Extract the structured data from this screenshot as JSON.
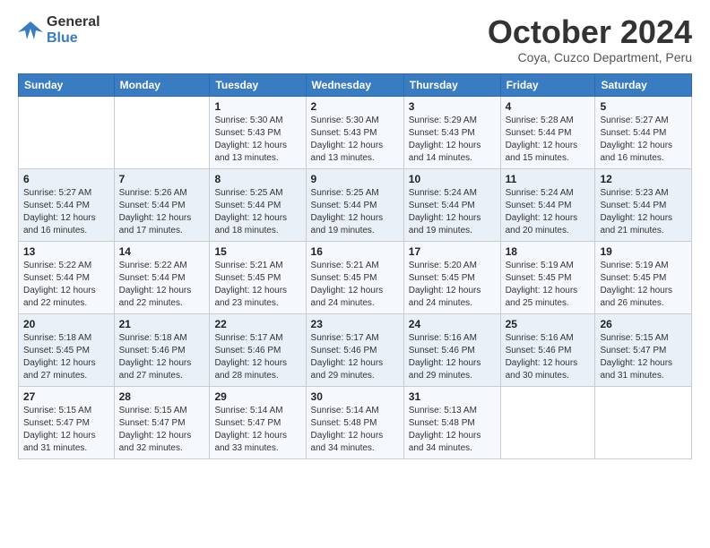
{
  "logo": {
    "general": "General",
    "blue": "Blue"
  },
  "header": {
    "month": "October 2024",
    "location": "Coya, Cuzco Department, Peru"
  },
  "weekdays": [
    "Sunday",
    "Monday",
    "Tuesday",
    "Wednesday",
    "Thursday",
    "Friday",
    "Saturday"
  ],
  "weeks": [
    [
      null,
      null,
      {
        "day": 1,
        "sunrise": "5:30 AM",
        "sunset": "5:43 PM",
        "daylight": "12 hours and 13 minutes."
      },
      {
        "day": 2,
        "sunrise": "5:30 AM",
        "sunset": "5:43 PM",
        "daylight": "12 hours and 13 minutes."
      },
      {
        "day": 3,
        "sunrise": "5:29 AM",
        "sunset": "5:43 PM",
        "daylight": "12 hours and 14 minutes."
      },
      {
        "day": 4,
        "sunrise": "5:28 AM",
        "sunset": "5:44 PM",
        "daylight": "12 hours and 15 minutes."
      },
      {
        "day": 5,
        "sunrise": "5:27 AM",
        "sunset": "5:44 PM",
        "daylight": "12 hours and 16 minutes."
      }
    ],
    [
      {
        "day": 6,
        "sunrise": "5:27 AM",
        "sunset": "5:44 PM",
        "daylight": "12 hours and 16 minutes."
      },
      {
        "day": 7,
        "sunrise": "5:26 AM",
        "sunset": "5:44 PM",
        "daylight": "12 hours and 17 minutes."
      },
      {
        "day": 8,
        "sunrise": "5:25 AM",
        "sunset": "5:44 PM",
        "daylight": "12 hours and 18 minutes."
      },
      {
        "day": 9,
        "sunrise": "5:25 AM",
        "sunset": "5:44 PM",
        "daylight": "12 hours and 19 minutes."
      },
      {
        "day": 10,
        "sunrise": "5:24 AM",
        "sunset": "5:44 PM",
        "daylight": "12 hours and 19 minutes."
      },
      {
        "day": 11,
        "sunrise": "5:24 AM",
        "sunset": "5:44 PM",
        "daylight": "12 hours and 20 minutes."
      },
      {
        "day": 12,
        "sunrise": "5:23 AM",
        "sunset": "5:44 PM",
        "daylight": "12 hours and 21 minutes."
      }
    ],
    [
      {
        "day": 13,
        "sunrise": "5:22 AM",
        "sunset": "5:44 PM",
        "daylight": "12 hours and 22 minutes."
      },
      {
        "day": 14,
        "sunrise": "5:22 AM",
        "sunset": "5:44 PM",
        "daylight": "12 hours and 22 minutes."
      },
      {
        "day": 15,
        "sunrise": "5:21 AM",
        "sunset": "5:45 PM",
        "daylight": "12 hours and 23 minutes."
      },
      {
        "day": 16,
        "sunrise": "5:21 AM",
        "sunset": "5:45 PM",
        "daylight": "12 hours and 24 minutes."
      },
      {
        "day": 17,
        "sunrise": "5:20 AM",
        "sunset": "5:45 PM",
        "daylight": "12 hours and 24 minutes."
      },
      {
        "day": 18,
        "sunrise": "5:19 AM",
        "sunset": "5:45 PM",
        "daylight": "12 hours and 25 minutes."
      },
      {
        "day": 19,
        "sunrise": "5:19 AM",
        "sunset": "5:45 PM",
        "daylight": "12 hours and 26 minutes."
      }
    ],
    [
      {
        "day": 20,
        "sunrise": "5:18 AM",
        "sunset": "5:45 PM",
        "daylight": "12 hours and 27 minutes."
      },
      {
        "day": 21,
        "sunrise": "5:18 AM",
        "sunset": "5:46 PM",
        "daylight": "12 hours and 27 minutes."
      },
      {
        "day": 22,
        "sunrise": "5:17 AM",
        "sunset": "5:46 PM",
        "daylight": "12 hours and 28 minutes."
      },
      {
        "day": 23,
        "sunrise": "5:17 AM",
        "sunset": "5:46 PM",
        "daylight": "12 hours and 29 minutes."
      },
      {
        "day": 24,
        "sunrise": "5:16 AM",
        "sunset": "5:46 PM",
        "daylight": "12 hours and 29 minutes."
      },
      {
        "day": 25,
        "sunrise": "5:16 AM",
        "sunset": "5:46 PM",
        "daylight": "12 hours and 30 minutes."
      },
      {
        "day": 26,
        "sunrise": "5:15 AM",
        "sunset": "5:47 PM",
        "daylight": "12 hours and 31 minutes."
      }
    ],
    [
      {
        "day": 27,
        "sunrise": "5:15 AM",
        "sunset": "5:47 PM",
        "daylight": "12 hours and 31 minutes."
      },
      {
        "day": 28,
        "sunrise": "5:15 AM",
        "sunset": "5:47 PM",
        "daylight": "12 hours and 32 minutes."
      },
      {
        "day": 29,
        "sunrise": "5:14 AM",
        "sunset": "5:47 PM",
        "daylight": "12 hours and 33 minutes."
      },
      {
        "day": 30,
        "sunrise": "5:14 AM",
        "sunset": "5:48 PM",
        "daylight": "12 hours and 34 minutes."
      },
      {
        "day": 31,
        "sunrise": "5:13 AM",
        "sunset": "5:48 PM",
        "daylight": "12 hours and 34 minutes."
      },
      null,
      null
    ]
  ],
  "labels": {
    "sunrise": "Sunrise:",
    "sunset": "Sunset:",
    "daylight": "Daylight: 12 hours"
  }
}
